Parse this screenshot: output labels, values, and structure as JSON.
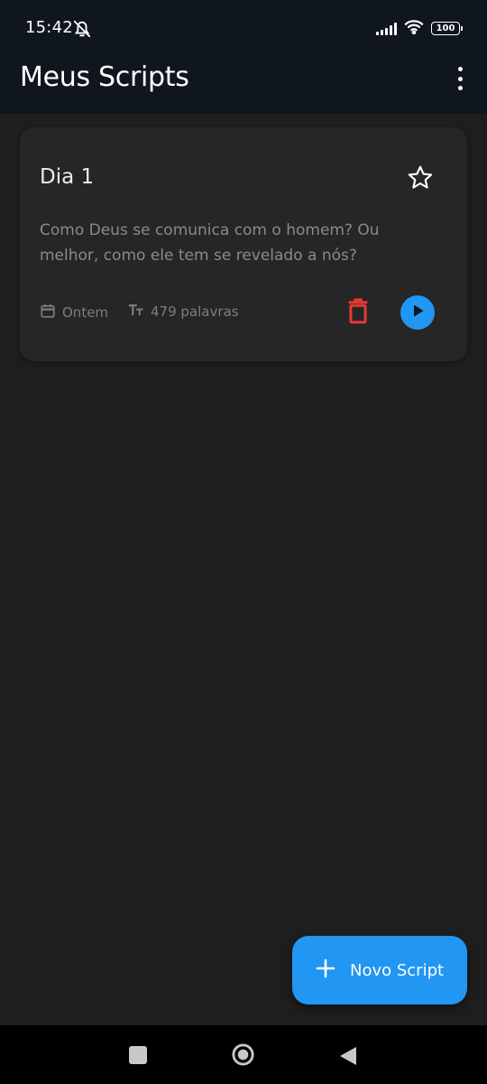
{
  "status_bar": {
    "time": "15:42",
    "battery": "100",
    "icons": [
      "alarm-off-icon",
      "signal-icon",
      "wifi-icon",
      "battery-icon"
    ]
  },
  "app_bar": {
    "title": "Meus Scripts",
    "menu_icon": "more-vert-icon"
  },
  "scripts": [
    {
      "title": "Dia 1",
      "description": "Como Deus se comunica com o homem? Ou melhor, como ele tem se revelado a nós?",
      "date": "Ontem",
      "words": "479 palavras",
      "favorite": false
    }
  ],
  "fab": {
    "label": "Novo Script",
    "icon": "plus-icon"
  },
  "nav_bar": {
    "icons": [
      "recents-icon",
      "home-icon",
      "back-icon"
    ]
  },
  "colors": {
    "app_bar_bg": "#0f161e",
    "background": "#1e1e1e",
    "card_bg": "#262626",
    "accent": "#2196f3",
    "delete": "#e53935"
  }
}
